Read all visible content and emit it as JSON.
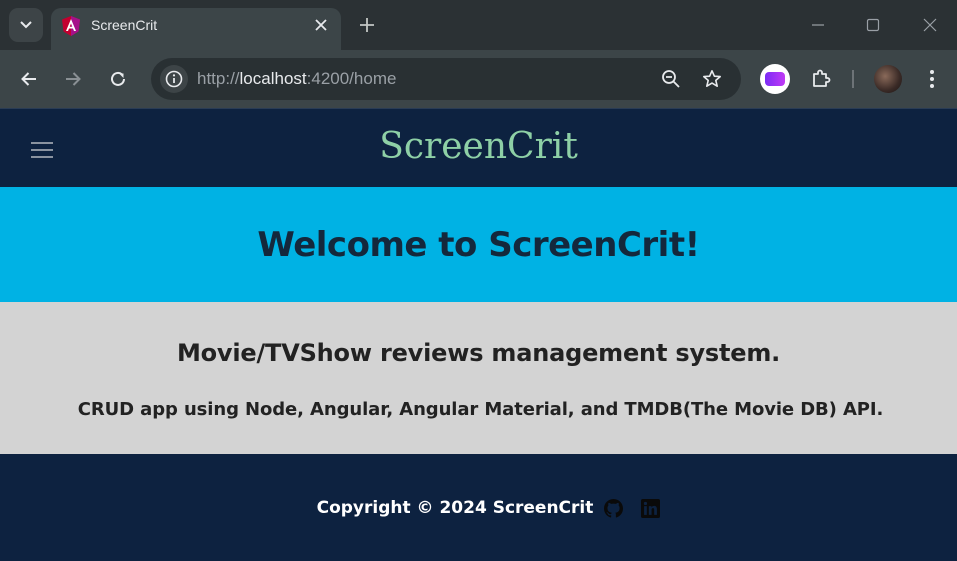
{
  "browser": {
    "tab": {
      "title": "ScreenCrit"
    },
    "address_bar": {
      "prefix": "http://",
      "host": "localhost",
      "rest": ":4200/home"
    },
    "icons": [
      "tab-search-icon",
      "angular-favicon",
      "close-icon",
      "plus-icon",
      "minimize-icon",
      "maximize-icon",
      "window-close-icon",
      "back-arrow-icon",
      "forward-arrow-icon",
      "reload-icon",
      "info-icon",
      "zoom-out-icon",
      "star-icon",
      "extension-avatar-icon",
      "puzzle-icon",
      "profile-avatar",
      "kebab-menu-icon"
    ]
  },
  "app": {
    "brand": "ScreenCrit",
    "hero_title": "Welcome to ScreenCrit!",
    "subtitle": "Movie/TVShow reviews management system.",
    "description": "CRUD app using Node, Angular, Angular Material, and TMDB(The Movie DB) API.",
    "footer": {
      "copyright": "Copyright © 2024 ScreenCrit",
      "social_icons": [
        "github-icon",
        "linkedin-icon"
      ]
    }
  },
  "colors": {
    "chrome_dark": "#2b3134",
    "chrome_toolbar": "#3c4548",
    "navy": "#0d2240",
    "brand_green": "#8ed0a6",
    "hero_blue": "#00b2e4",
    "about_gray": "#d3d3d3"
  }
}
